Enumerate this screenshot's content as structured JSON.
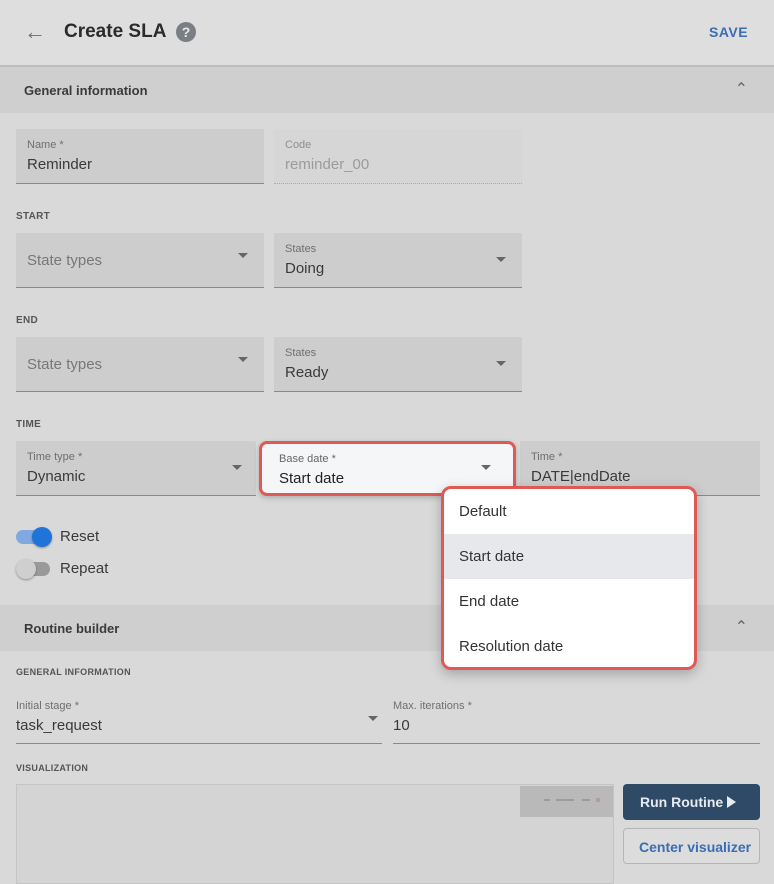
{
  "header": {
    "back_icon": "arrow-left-icon",
    "title": "Create SLA",
    "help_icon": "help-circle-icon",
    "save_label": "SAVE"
  },
  "general": {
    "section_label": "General information",
    "name": {
      "label": "Name *",
      "value": "Reminder"
    },
    "code": {
      "label": "Code",
      "value": "reminder_00"
    },
    "start": {
      "heading": "START",
      "state_types_placeholder": "State types",
      "states": {
        "label": "States",
        "value": "Doing"
      }
    },
    "end": {
      "heading": "END",
      "state_types_placeholder": "State types",
      "states": {
        "label": "States",
        "value": "Ready"
      }
    },
    "time": {
      "heading": "TIME",
      "time_type": {
        "label": "Time type *",
        "value": "Dynamic"
      },
      "base_date": {
        "label": "Base date *",
        "value": "Start date"
      },
      "time": {
        "label": "Time *",
        "value": "DATE|endDate"
      }
    },
    "reset": {
      "label": "Reset",
      "on": true
    },
    "repeat": {
      "label": "Repeat",
      "on": false
    }
  },
  "base_date_menu": {
    "options": [
      "Default",
      "Start date",
      "End date",
      "Resolution date"
    ],
    "selected": "Start date"
  },
  "routine": {
    "section_label": "Routine builder",
    "general_heading": "GENERAL INFORMATION",
    "initial_stage": {
      "label": "Initial stage *",
      "value": "task_request"
    },
    "max_iterations": {
      "label": "Max. iterations *",
      "value": "10"
    },
    "visualization_heading": "VISUALIZATION",
    "run_label": "Run Routine",
    "center_label": "Center visualizer"
  },
  "colors": {
    "accent": "#3b6db3",
    "highlight": "#e05a55",
    "toggle_on": "#1f73d9",
    "run_button": "#2f4a66"
  }
}
